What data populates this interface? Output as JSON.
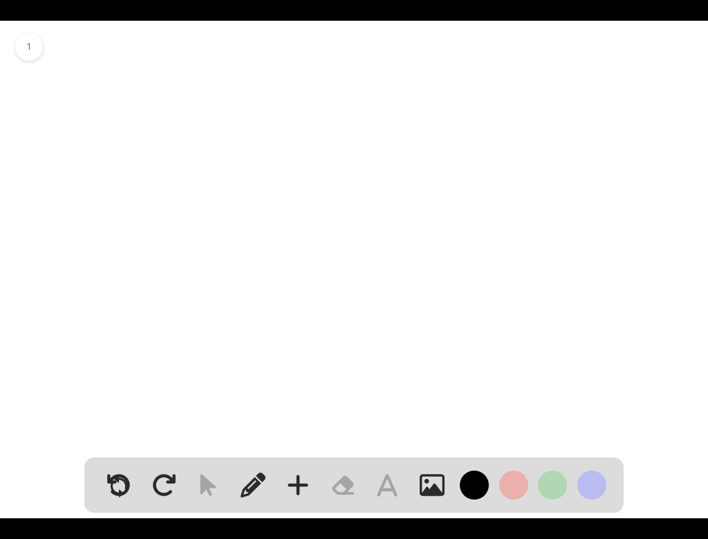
{
  "page": {
    "number": "1"
  },
  "toolbar": {
    "tools": [
      {
        "name": "undo",
        "icon": "undo-icon",
        "muted": false
      },
      {
        "name": "redo",
        "icon": "redo-icon",
        "muted": false
      },
      {
        "name": "pointer",
        "icon": "pointer-icon",
        "muted": true
      },
      {
        "name": "pencil",
        "icon": "pencil-icon",
        "muted": false
      },
      {
        "name": "add",
        "icon": "plus-icon",
        "muted": false
      },
      {
        "name": "eraser",
        "icon": "eraser-icon",
        "muted": true
      },
      {
        "name": "text",
        "icon": "text-icon",
        "muted": true
      },
      {
        "name": "image",
        "icon": "image-icon",
        "muted": false
      }
    ],
    "colors": [
      {
        "name": "black",
        "hex": "#000000"
      },
      {
        "name": "red",
        "hex": "#ebb0ac"
      },
      {
        "name": "green",
        "hex": "#b0d7b2"
      },
      {
        "name": "purple",
        "hex": "#b8bcf0"
      }
    ]
  }
}
